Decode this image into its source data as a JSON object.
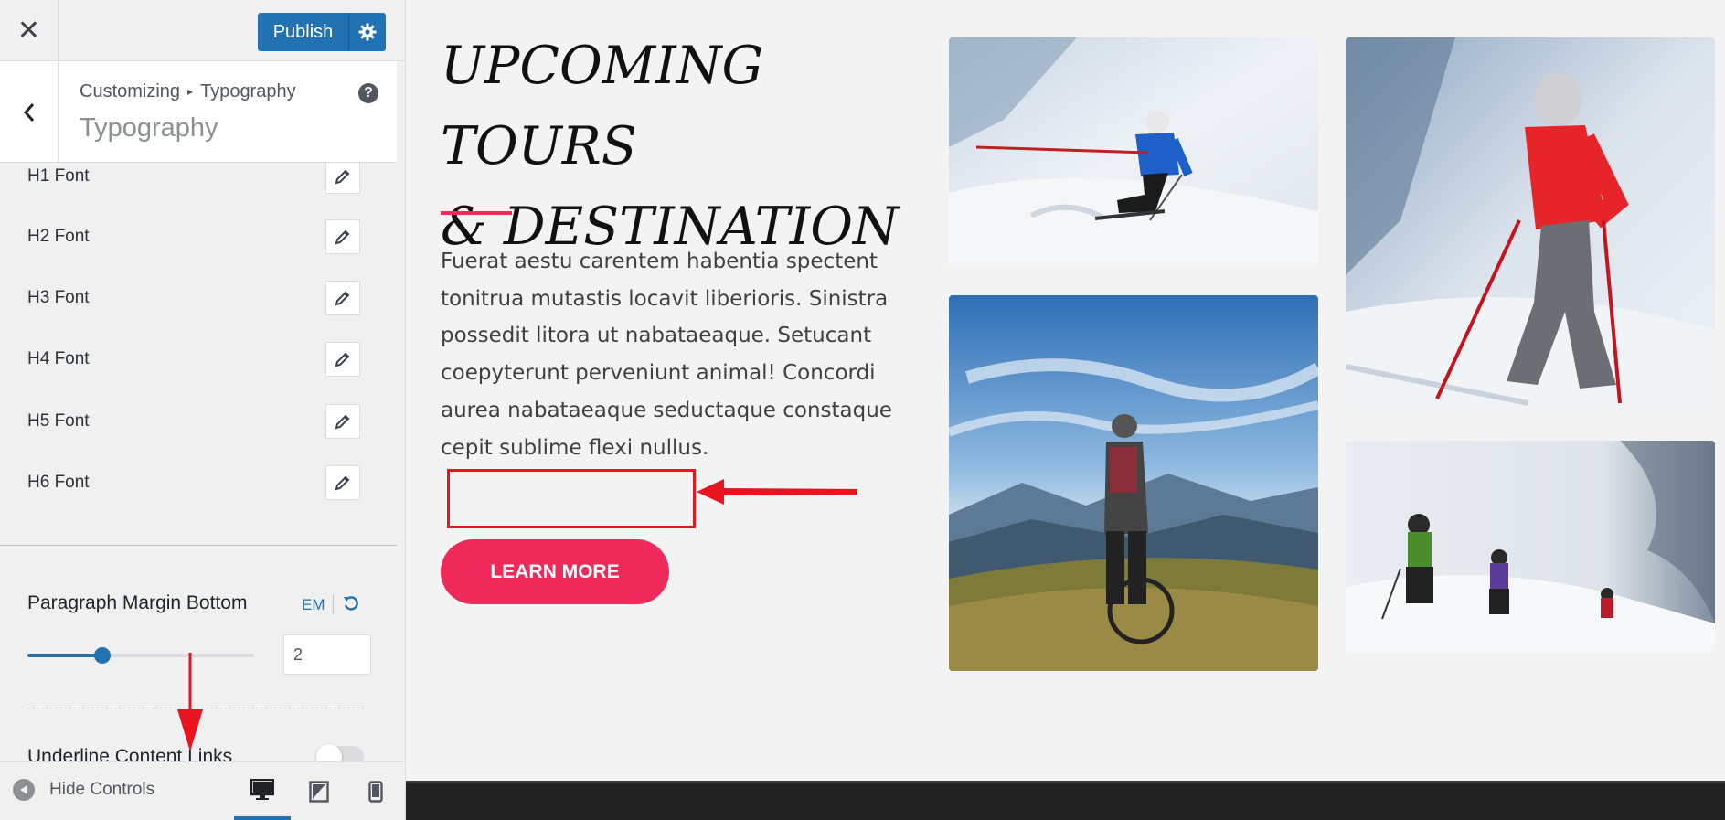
{
  "customizer": {
    "close_icon": "close-icon",
    "publish_label": "Publish",
    "publish_settings_icon": "gear-icon",
    "back_icon": "chevron-left-icon",
    "breadcrumb": {
      "root": "Customizing",
      "separator": "▸",
      "current": "Typography"
    },
    "section_title": "Typography",
    "help_icon": "help-icon",
    "help_glyph": "?",
    "font_controls": [
      {
        "label": "H1 Font"
      },
      {
        "label": "H2 Font"
      },
      {
        "label": "H3 Font"
      },
      {
        "label": "H4 Font"
      },
      {
        "label": "H5 Font"
      },
      {
        "label": "H6 Font"
      }
    ],
    "paragraph_margin_bottom": {
      "label": "Paragraph Margin Bottom",
      "unit": "EM",
      "value": "2",
      "slider_fraction": 0.33
    },
    "underline_links": {
      "label": "Underline Content Links",
      "enabled": false
    },
    "footer": {
      "hide_controls_label": "Hide Controls",
      "devices": [
        "desktop",
        "tablet",
        "mobile"
      ],
      "active_device": "desktop"
    }
  },
  "preview": {
    "title_line1": "UPCOMING TOURS",
    "title_line2": "& DESTINATION",
    "paragraph": "Fuerat aestu carentem habentia spectent tonitrua mutastis locavit liberioris. Sinistra possedit litora ut nabataeaque. Setucant coepyterunt perveniunt animal! Concordi aurea nabataeaque seductaque constaque cepit sublime flexi nullus.",
    "button_label": "LEARN MORE",
    "photos": [
      "skier-photo",
      "mountain-biker-photo",
      "skier-woman-photo",
      "hikers-photo"
    ]
  },
  "colors": {
    "accent_blue": "#2271b1",
    "accent_pink": "#ee2a5a",
    "annotation_red": "#e8141f"
  }
}
